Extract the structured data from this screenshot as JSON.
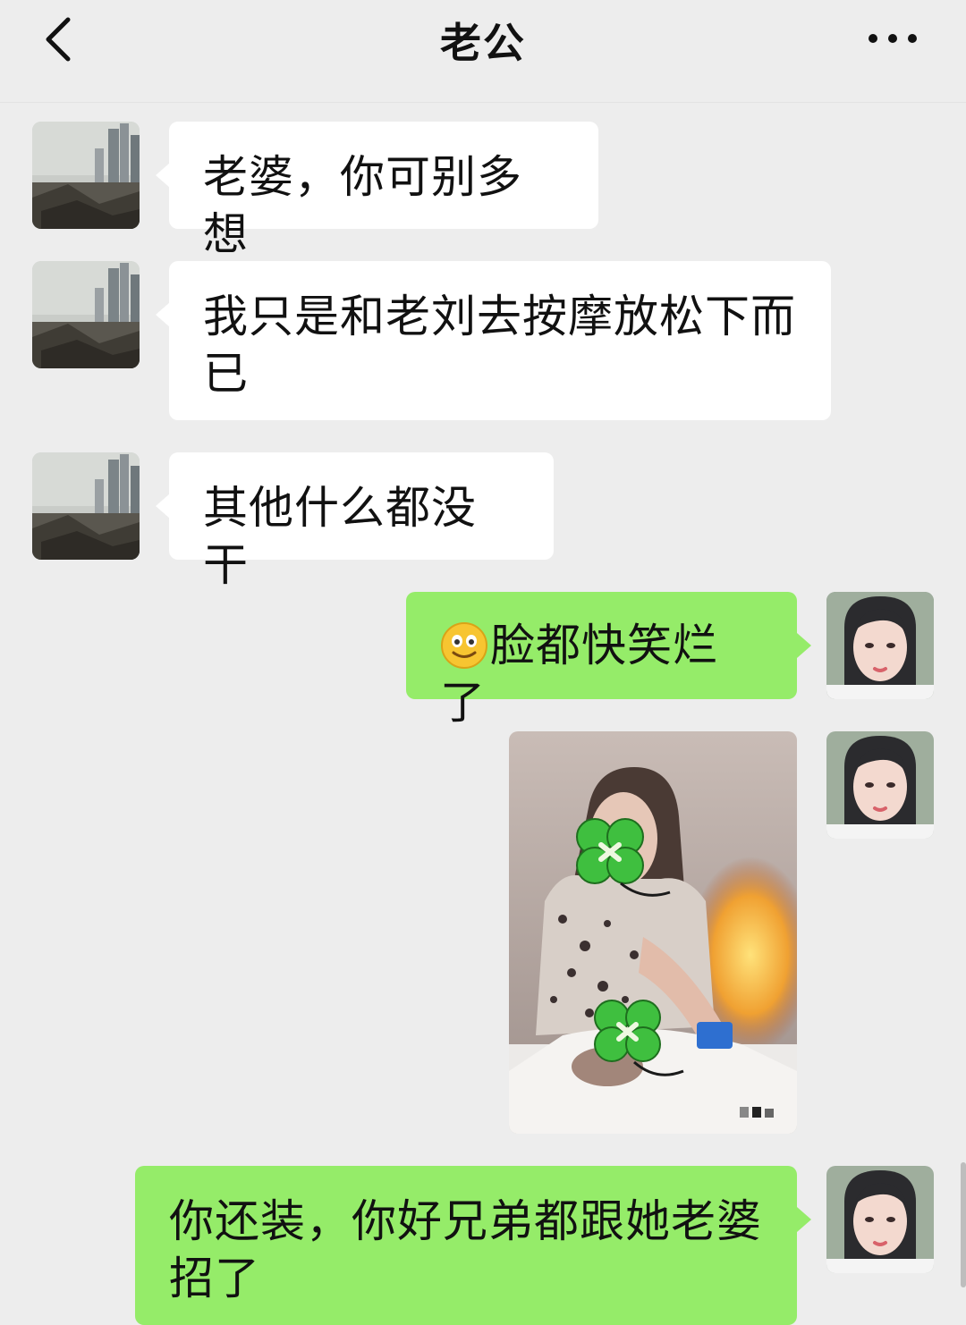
{
  "header": {
    "title": "老公",
    "back_icon": "chevron-left-icon",
    "more_icon": "more-dots-icon"
  },
  "messages": [
    {
      "side": "left",
      "text": "老婆，你可别多想"
    },
    {
      "side": "left",
      "text": "我只是和老刘去按摩放松下而已"
    },
    {
      "side": "left",
      "text": "其他什么都没干"
    },
    {
      "side": "right",
      "emoji": "smile-emoji-icon",
      "text": "脸都快笑烂了"
    },
    {
      "side": "right",
      "image": "massage-photo"
    },
    {
      "side": "right",
      "text": "你还装，你好兄弟都跟她老婆招了"
    }
  ],
  "colors": {
    "background": "#ededed",
    "incoming_bubble": "#ffffff",
    "outgoing_bubble": "#95ec69"
  }
}
